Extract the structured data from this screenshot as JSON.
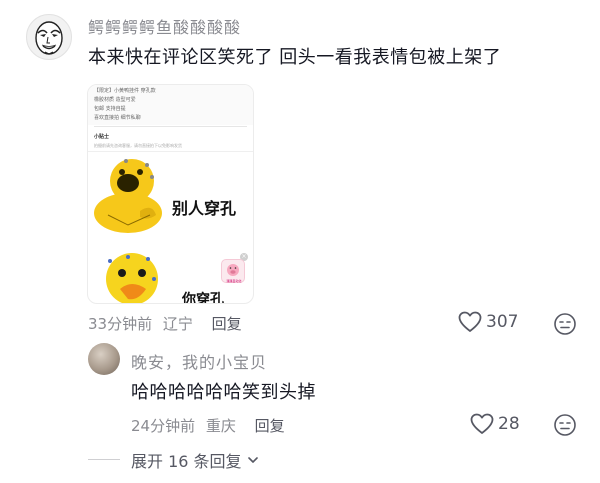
{
  "comment": {
    "username": "鳄鳄鳄鳄鱼酸酸酸酸",
    "text": "本来快在评论区笑死了 回头一看我表情包被上架了",
    "image": {
      "line1": "【限定】小黄鸭挂件 穿孔款",
      "line2": "橡胶材质 造型可爱",
      "line3": "包邮 支持自提",
      "line4": "喜欢直接拍 细节私聊",
      "tip_title": "小贴士",
      "tip_body": "拍摄前请先咨询客服，请勿直接拍下以免影响发货",
      "caption_top": "别人穿孔",
      "caption_bottom": "你穿孔",
      "pig_label": "猪猪自动化"
    },
    "time": "33分钟前",
    "location": "辽宁",
    "reply_label": "回复",
    "likes": "307"
  },
  "reply": {
    "username": "晚安，我的小宝贝",
    "text": "哈哈哈哈哈哈笑到头掉",
    "time": "24分钟前",
    "location": "重庆",
    "reply_label": "回复",
    "likes": "28"
  },
  "expand_label": "展开 16 条回复",
  "icons": {
    "like": "heart-outline-icon",
    "react": "emoji-face-icon",
    "expand": "chevron-down-icon"
  }
}
